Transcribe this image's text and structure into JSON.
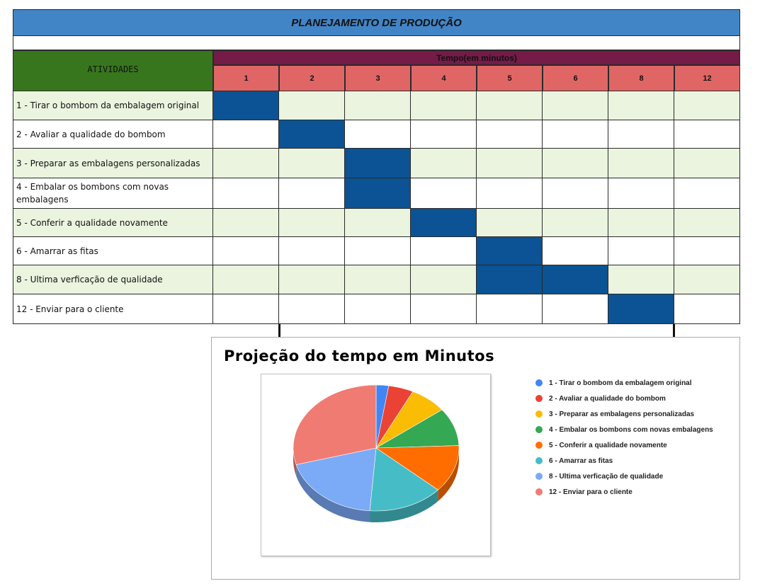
{
  "table": {
    "title": "PLANEJAMENTO DE PRODUÇÃO",
    "activities_header": "ATIVIDADES",
    "time_header": "Tempo(em minutos)",
    "time_columns": [
      "1",
      "2",
      "3",
      "4",
      "5",
      "6",
      "8",
      "12"
    ],
    "rows": [
      {
        "label": "1 - Tirar o bombom da embalagem original",
        "filled": [
          0
        ]
      },
      {
        "label": "2 - Avaliar a qualidade do bombom",
        "filled": [
          1
        ]
      },
      {
        "label": "3 - Preparar as embalagens personalizadas",
        "filled": [
          2
        ]
      },
      {
        "label": "4 - Embalar os bombons com novas embalagens",
        "filled": [
          2
        ]
      },
      {
        "label": "5 - Conferir a qualidade novamente",
        "filled": [
          3
        ]
      },
      {
        "label": "6 - Amarrar as fitas",
        "filled": [
          4
        ]
      },
      {
        "label": "8 - Ultima verficação de qualidade",
        "filled": [
          4,
          5
        ]
      },
      {
        "label": "12 - Enviar para o cliente",
        "filled": [
          6
        ]
      }
    ],
    "colors": {
      "title": "#4285c6",
      "activities": "#38761d",
      "time": "#741b47",
      "numbers": "#e06666",
      "filled": "#0b5394",
      "stripe": "#eaf4df"
    }
  },
  "chart_data": {
    "type": "pie",
    "title": "Projeção do tempo em Minutos",
    "three_d": true,
    "legend_position": "right",
    "series": [
      {
        "name": "1 - Tirar o bombom da embalagem original",
        "value": 1,
        "color": "#4285f4"
      },
      {
        "name": "2 - Avaliar a qualidade do bombom",
        "value": 2,
        "color": "#ea4335"
      },
      {
        "name": "3 - Preparar as embalagens personalizadas",
        "value": 3,
        "color": "#fbbc04"
      },
      {
        "name": "4 - Embalar os bombons com novas embalagens",
        "value": 4,
        "color": "#34a853"
      },
      {
        "name": "5 - Conferir a qualidade novamente",
        "value": 5,
        "color": "#ff6d01"
      },
      {
        "name": "6 - Amarrar as fitas",
        "value": 6,
        "color": "#46bdc6"
      },
      {
        "name": "8 - Ultima verficação de qualidade",
        "value": 8,
        "color": "#7baaf7"
      },
      {
        "name": "12 - Enviar para o cliente",
        "value": 12,
        "color": "#f07b72"
      }
    ]
  }
}
